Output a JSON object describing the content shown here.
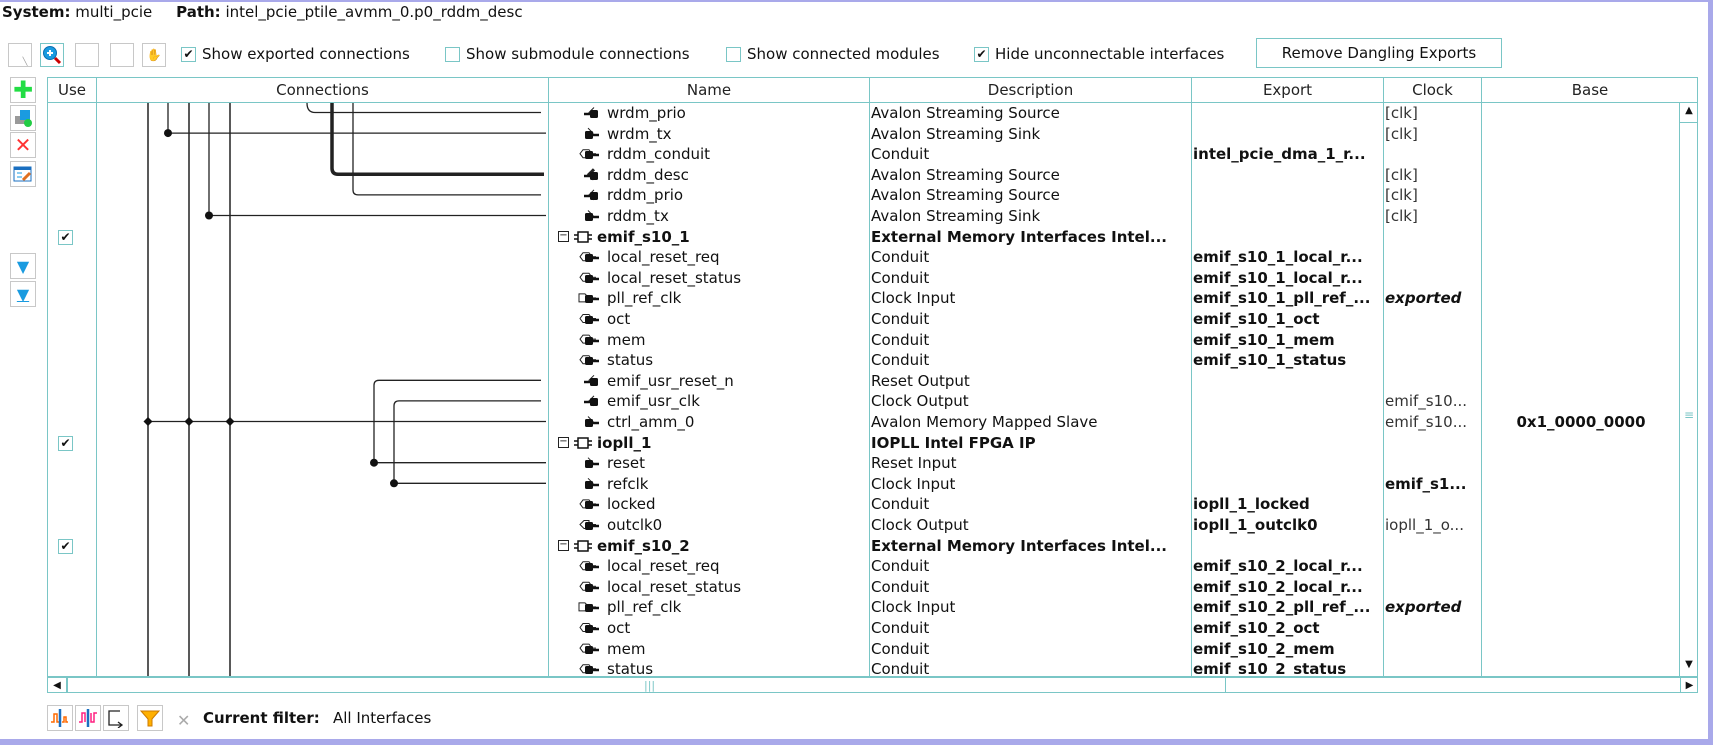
{
  "header": {
    "system_label": "System:",
    "system_value": "multi_pcie",
    "path_label": "Path:",
    "path_value": "intel_pcie_ptile_avmm_0.p0_rddm_desc"
  },
  "toolbar": {
    "checkboxes": [
      {
        "label": "Show exported connections",
        "checked": true
      },
      {
        "label": "Show submodule connections",
        "checked": false
      },
      {
        "label": "Show connected modules",
        "checked": false
      },
      {
        "label": "Hide unconnectable interfaces",
        "checked": true
      }
    ],
    "remove_dangling_label": "Remove Dangling Exports"
  },
  "table": {
    "columns": [
      "Use",
      "Connections",
      "Name",
      "Description",
      "Export",
      "Clock",
      "Base"
    ],
    "rows": [
      {
        "kind": "port",
        "port": "source",
        "name": "wrdm_prio",
        "desc": "Avalon Streaming Source",
        "export": "",
        "clock": "[clk]",
        "base": ""
      },
      {
        "kind": "port",
        "port": "sink",
        "name": "wrdm_tx",
        "desc": "Avalon Streaming Sink",
        "export": "",
        "clock": "[clk]",
        "base": ""
      },
      {
        "kind": "port",
        "port": "conduit",
        "name": "rddm_conduit",
        "desc": "Conduit",
        "export": "intel_pcie_dma_1_r...",
        "clock": "",
        "base": ""
      },
      {
        "kind": "port",
        "port": "source",
        "name": "rddm_desc",
        "desc": "Avalon Streaming Source",
        "export": "",
        "clock": "[clk]",
        "base": ""
      },
      {
        "kind": "port",
        "port": "source",
        "name": "rddm_prio",
        "desc": "Avalon Streaming Source",
        "export": "",
        "clock": "[clk]",
        "base": ""
      },
      {
        "kind": "port",
        "port": "sink",
        "name": "rddm_tx",
        "desc": "Avalon Streaming Sink",
        "export": "",
        "clock": "[clk]",
        "base": ""
      },
      {
        "kind": "group",
        "name": "emif_s10_1",
        "desc": "External Memory Interfaces Intel...",
        "use": true
      },
      {
        "kind": "port",
        "port": "conduit",
        "name": "local_reset_req",
        "desc": "Conduit",
        "export": "emif_s10_1_local_r...",
        "clock": "",
        "base": ""
      },
      {
        "kind": "port",
        "port": "conduit",
        "name": "local_reset_status",
        "desc": "Conduit",
        "export": "emif_s10_1_local_r...",
        "clock": "",
        "base": ""
      },
      {
        "kind": "port",
        "port": "clockin",
        "name": "pll_ref_clk",
        "desc": "Clock Input",
        "export": "emif_s10_1_pll_ref_...",
        "clock": "exported",
        "clock_style": "bi",
        "base": ""
      },
      {
        "kind": "port",
        "port": "conduit",
        "name": "oct",
        "desc": "Conduit",
        "export": "emif_s10_1_oct",
        "clock": "",
        "base": ""
      },
      {
        "kind": "port",
        "port": "conduit",
        "name": "mem",
        "desc": "Conduit",
        "export": "emif_s10_1_mem",
        "clock": "",
        "base": ""
      },
      {
        "kind": "port",
        "port": "conduit",
        "name": "status",
        "desc": "Conduit",
        "export": "emif_s10_1_status",
        "clock": "",
        "base": ""
      },
      {
        "kind": "port",
        "port": "source",
        "name": "emif_usr_reset_n",
        "desc": "Reset Output",
        "export": "",
        "clock": "",
        "base": ""
      },
      {
        "kind": "port",
        "port": "source",
        "name": "emif_usr_clk",
        "desc": "Clock Output",
        "export": "",
        "clock": "emif_s10...",
        "base": ""
      },
      {
        "kind": "port",
        "port": "sink",
        "name": "ctrl_amm_0",
        "desc": "Avalon Memory Mapped Slave",
        "export": "",
        "clock": "emif_s10...",
        "base": "0x1_0000_0000"
      },
      {
        "kind": "group",
        "name": "iopll_1",
        "desc": "IOPLL Intel FPGA IP",
        "use": true
      },
      {
        "kind": "port",
        "port": "sink",
        "name": "reset",
        "desc": "Reset Input",
        "export": "",
        "clock": "",
        "base": ""
      },
      {
        "kind": "port",
        "port": "sink",
        "name": "refclk",
        "desc": "Clock Input",
        "export": "",
        "clock": "emif_s1...",
        "clock_style": "b",
        "base": ""
      },
      {
        "kind": "port",
        "port": "conduit",
        "name": "locked",
        "desc": "Conduit",
        "export": "iopll_1_locked",
        "clock": "",
        "base": ""
      },
      {
        "kind": "port",
        "port": "clockout",
        "name": "outclk0",
        "desc": "Clock Output",
        "export": "iopll_1_outclk0",
        "clock": "iopll_1_o...",
        "base": ""
      },
      {
        "kind": "group",
        "name": "emif_s10_2",
        "desc": "External Memory Interfaces Intel...",
        "use": true
      },
      {
        "kind": "port",
        "port": "conduit",
        "name": "local_reset_req",
        "desc": "Conduit",
        "export": "emif_s10_2_local_r...",
        "clock": "",
        "base": ""
      },
      {
        "kind": "port",
        "port": "conduit",
        "name": "local_reset_status",
        "desc": "Conduit",
        "export": "emif_s10_2_local_r...",
        "clock": "",
        "base": ""
      },
      {
        "kind": "port",
        "port": "clockin",
        "name": "pll_ref_clk",
        "desc": "Clock Input",
        "export": "emif_s10_2_pll_ref_...",
        "clock": "exported",
        "clock_style": "bi",
        "base": ""
      },
      {
        "kind": "port",
        "port": "conduit",
        "name": "oct",
        "desc": "Conduit",
        "export": "emif_s10_2_oct",
        "clock": "",
        "base": ""
      },
      {
        "kind": "port",
        "port": "conduit",
        "name": "mem",
        "desc": "Conduit",
        "export": "emif_s10_2_mem",
        "clock": "",
        "base": ""
      },
      {
        "kind": "port",
        "port": "conduit",
        "name": "status",
        "desc": "Conduit",
        "export": "emif_s10_2_status",
        "clock": "",
        "base": ""
      }
    ]
  },
  "footer": {
    "filter_label": "Current filter:",
    "filter_value": "All Interfaces"
  },
  "colors": {
    "accent": "#7ac6c6",
    "frame": "#a9a9ea",
    "add": "#22dd44",
    "remove": "#ff3333",
    "arrow": "#1a9be0"
  }
}
